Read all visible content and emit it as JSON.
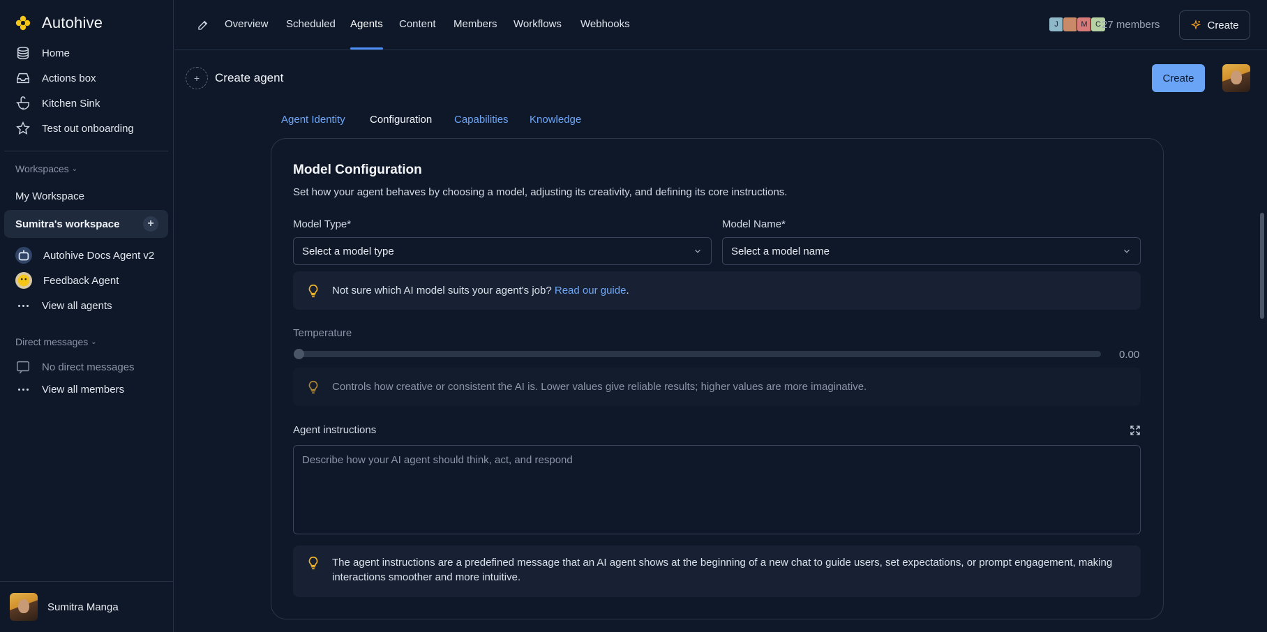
{
  "app": {
    "name": "Autohive"
  },
  "sidebar": {
    "nav": [
      {
        "label": "Home",
        "icon": "layers-icon"
      },
      {
        "label": "Actions box",
        "icon": "inbox-icon"
      },
      {
        "label": "Kitchen Sink",
        "icon": "sink-icon"
      },
      {
        "label": "Test out onboarding",
        "icon": "star-icon"
      }
    ],
    "workspaces_label": "Workspaces",
    "my_workspace": "My Workspace",
    "active_workspace": "Sumitra's workspace",
    "agents": [
      {
        "label": "Autohive Docs Agent v2"
      },
      {
        "label": "Feedback Agent"
      }
    ],
    "view_all_agents": "View all agents",
    "direct_messages_label": "Direct messages",
    "no_direct_messages": "No direct messages",
    "view_all_members": "View all members",
    "user_name": "Sumitra Manga"
  },
  "topnav": {
    "tabs": [
      "Overview",
      "Scheduled",
      "Agents",
      "Content",
      "Members",
      "Workflows",
      "Webhooks"
    ],
    "active_tab": "Agents",
    "member_initials": [
      "J",
      "",
      "M",
      "C"
    ],
    "member_count": "27 members",
    "create_label": "Create"
  },
  "page": {
    "title": "Create agent",
    "create_button": "Create",
    "subtabs": [
      "Agent Identity",
      "Configuration",
      "Capabilities",
      "Knowledge"
    ],
    "active_subtab": "Configuration"
  },
  "card": {
    "title": "Model Configuration",
    "description": "Set how your agent behaves by choosing a model, adjusting its creativity, and defining its core instructions.",
    "model_type_label": "Model Type*",
    "model_type_placeholder": "Select a model type",
    "model_name_label": "Model Name*",
    "model_name_placeholder": "Select a model name",
    "model_hint_text": "Not sure which AI model suits your agent's job?",
    "model_hint_link": "Read our guide",
    "model_hint_suffix": ".",
    "temperature_label": "Temperature",
    "temperature_value": "0.00",
    "temperature_hint": "Controls how creative or consistent the AI is. Lower values give reliable results; higher values are more imaginative.",
    "instructions_label": "Agent instructions",
    "instructions_placeholder": "Describe how your AI agent should think, act, and respond",
    "instructions_hint": "The agent instructions are a predefined message that an AI agent shows at the beginning of a new chat to guide users, set expectations, or prompt engagement, making interactions smoother and more intuitive."
  },
  "colors": {
    "background": "#0f1829",
    "accent": "#4d8ff5",
    "link": "#6ea6f7",
    "primary_button": "#6aa4f7",
    "bulb": "#f0b429"
  }
}
